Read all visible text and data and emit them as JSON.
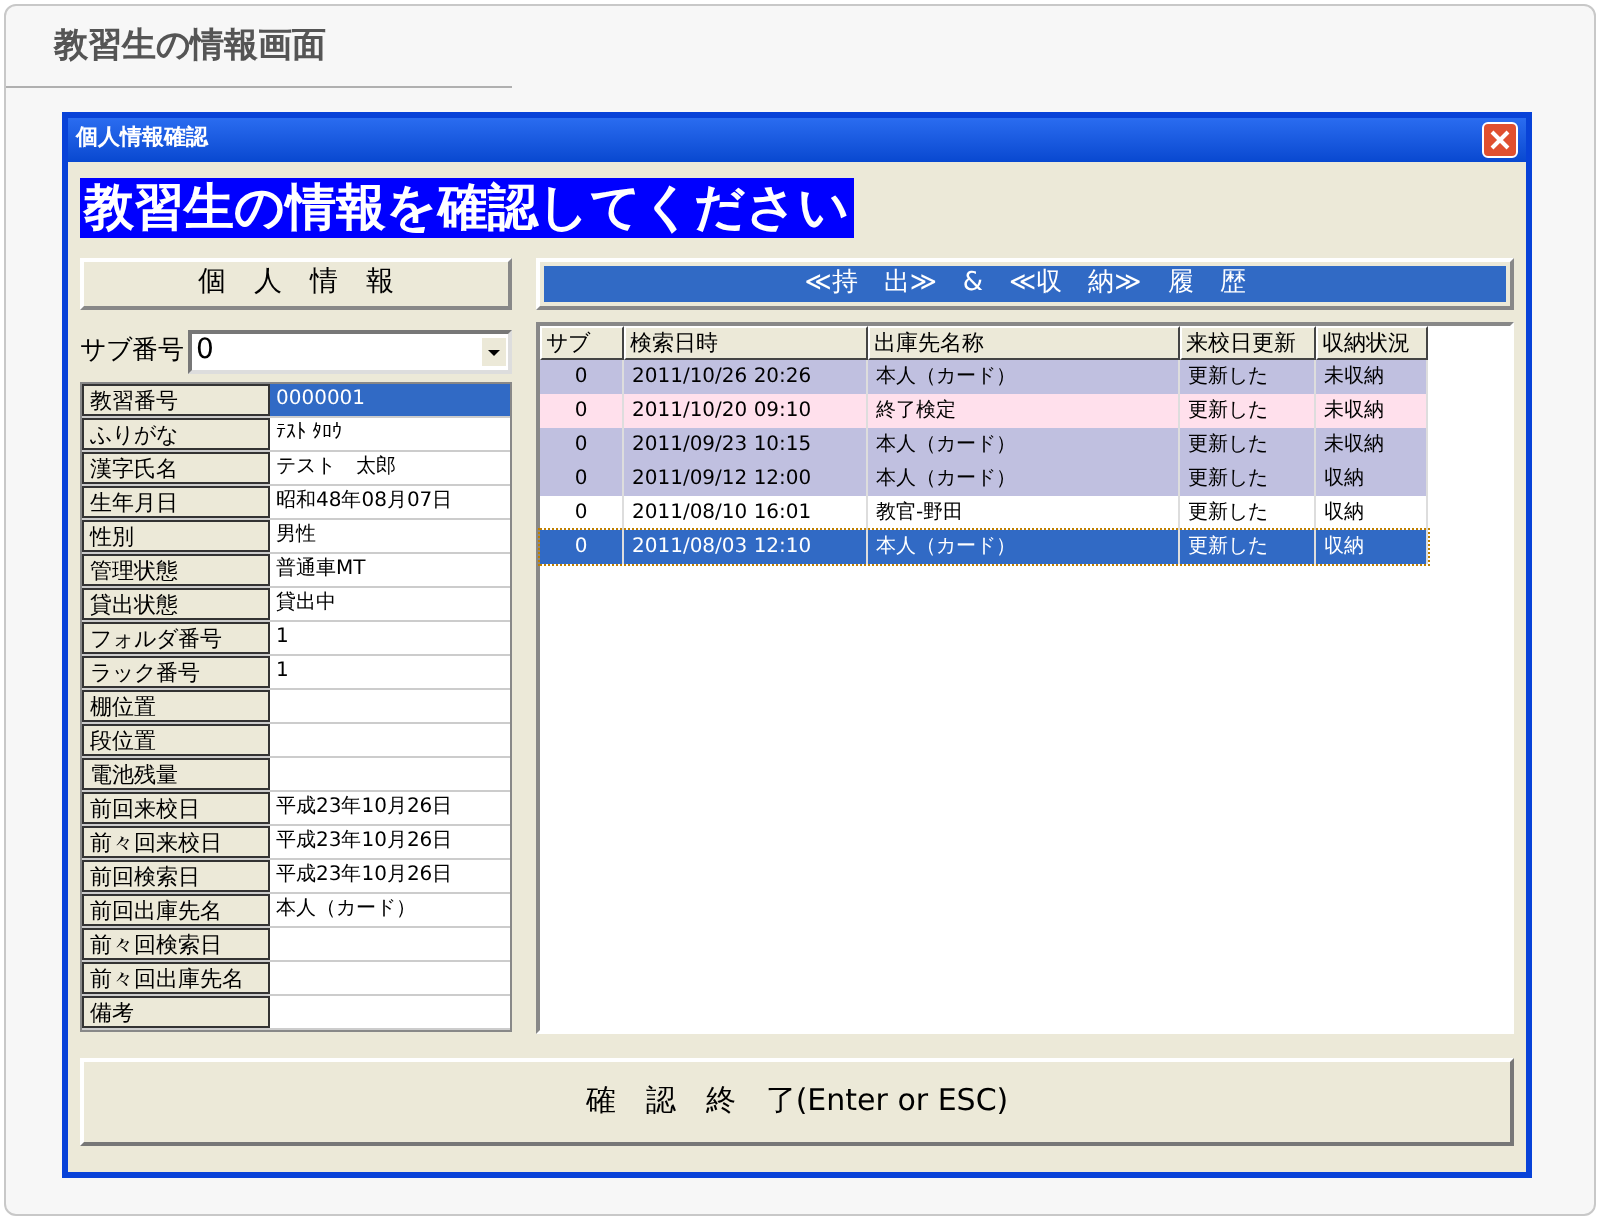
{
  "page_title": "教習生の情報画面",
  "window": {
    "title": "個人情報確認"
  },
  "banner": "教習生の情報を確認してください",
  "personal": {
    "heading": "個　人　情　報",
    "sub_label": "サブ番号",
    "sub_value": "0",
    "fields": [
      {
        "label": "教習番号",
        "value": "0000001",
        "selected": true
      },
      {
        "label": "ふりがな",
        "value": "ﾃｽﾄ ﾀﾛｳ",
        "selected": false
      },
      {
        "label": "漢字氏名",
        "value": "テスト　太郎",
        "selected": false
      },
      {
        "label": "生年月日",
        "value": "昭和48年08月07日",
        "selected": false
      },
      {
        "label": "性別",
        "value": "男性",
        "selected": false
      },
      {
        "label": "管理状態",
        "value": "普通車MT",
        "selected": false
      },
      {
        "label": "貸出状態",
        "value": "貸出中",
        "selected": false
      },
      {
        "label": "フォルダ番号",
        "value": "1",
        "selected": false
      },
      {
        "label": "ラック番号",
        "value": "1",
        "selected": false
      },
      {
        "label": "棚位置",
        "selected": false
      },
      {
        "label": "段位置",
        "selected": false
      },
      {
        "label": "電池残量",
        "selected": false
      },
      {
        "label": "前回来校日",
        "value": "平成23年10月26日",
        "selected": false
      },
      {
        "label": "前々回来校日",
        "value": "平成23年10月26日",
        "selected": false
      },
      {
        "label": "前回検索日",
        "value": "平成23年10月26日",
        "selected": false
      },
      {
        "label": "前回出庫先名",
        "value": "本人（カード）",
        "selected": false
      },
      {
        "label": "前々回検索日",
        "selected": false
      },
      {
        "label": "前々回出庫先名",
        "selected": false
      },
      {
        "label": "備考",
        "selected": false
      }
    ]
  },
  "history": {
    "heading": "≪持　出≫　&　≪収　納≫　履　歴",
    "columns": [
      "サブ",
      "検索日時",
      "出庫先名称",
      "来校日更新",
      "収納状況"
    ],
    "rows": [
      {
        "cells": [
          "0",
          "2011/10/26 20:26",
          "本人（カード）",
          "更新した",
          "未収納"
        ],
        "color": "#c0c0e0",
        "selected": false
      },
      {
        "cells": [
          "0",
          "2011/10/20 09:10",
          "終了検定",
          "更新した",
          "未収納"
        ],
        "color": "#ffe0ec",
        "selected": false
      },
      {
        "cells": [
          "0",
          "2011/09/23 10:15",
          "本人（カード）",
          "更新した",
          "未収納"
        ],
        "color": "#c0c0e0",
        "selected": false
      },
      {
        "cells": [
          "0",
          "2011/09/12 12:00",
          "本人（カード）",
          "更新した",
          "収納"
        ],
        "color": "#c0c0e0",
        "selected": false
      },
      {
        "cells": [
          "0",
          "2011/08/10 16:01",
          "教官-野田",
          "更新した",
          "収納"
        ],
        "color": "#ffffff",
        "selected": false
      },
      {
        "cells": [
          "0",
          "2011/08/03 12:10",
          "本人（カード）",
          "更新した",
          "収納"
        ],
        "selected": true
      }
    ]
  },
  "close_button": "確　認　終　了(Enter or ESC)"
}
